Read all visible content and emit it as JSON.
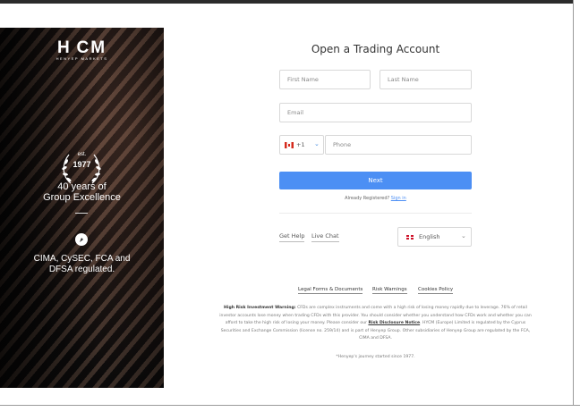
{
  "brand": {
    "logo_text": "H CM",
    "logo_sub": "HENYEP MARKETS"
  },
  "badge": {
    "est_label": "est.",
    "year": "1977"
  },
  "left_panel": {
    "years_line1": "40 years of",
    "years_line2": "Group Excellence",
    "regulated_line1": "CIMA, CySEC, FCA and",
    "regulated_line2": "DFSA regulated."
  },
  "form": {
    "title": "Open a Trading Account",
    "first_name_placeholder": "First Name",
    "last_name_placeholder": "Last Name",
    "email_placeholder": "Email",
    "country_code": "+1",
    "phone_placeholder": "Phone",
    "next_label": "Next",
    "already_registered": "Already Registered?",
    "sign_in_label": "Sign in"
  },
  "support": {
    "get_help": "Get Help",
    "live_chat": "Live Chat",
    "language": "English"
  },
  "footer": {
    "links": [
      "Legal Forms & Documents",
      "Risk Warnings",
      "Cookies Policy"
    ],
    "warning_bold": "High Risk Investment Warning:",
    "warning_text_1": " CFDs are complex instruments and come with a high risk of losing money rapidly due to leverage. 76% of retail investor accounts lose money when trading CFDs with this provider. You should consider whether you understand how CFDs work and whether you can afford to take the high risk of losing your money. Please consider our ",
    "risk_disclosure": "Risk Disclosure Notice",
    "warning_text_2": ". HYCM (Europe) Limited is regulated by the Cyprus Securities and Exchange Commission (license no. 259/14) and is part of Henyep Group. Other subsidiaries of Henyep Group are regulated by the FCA, CIMA and DFSA.",
    "journey": "*Henyep's journey started since 1977."
  },
  "colors": {
    "accent": "#4c8ff4",
    "panel_dark": "#151313"
  }
}
